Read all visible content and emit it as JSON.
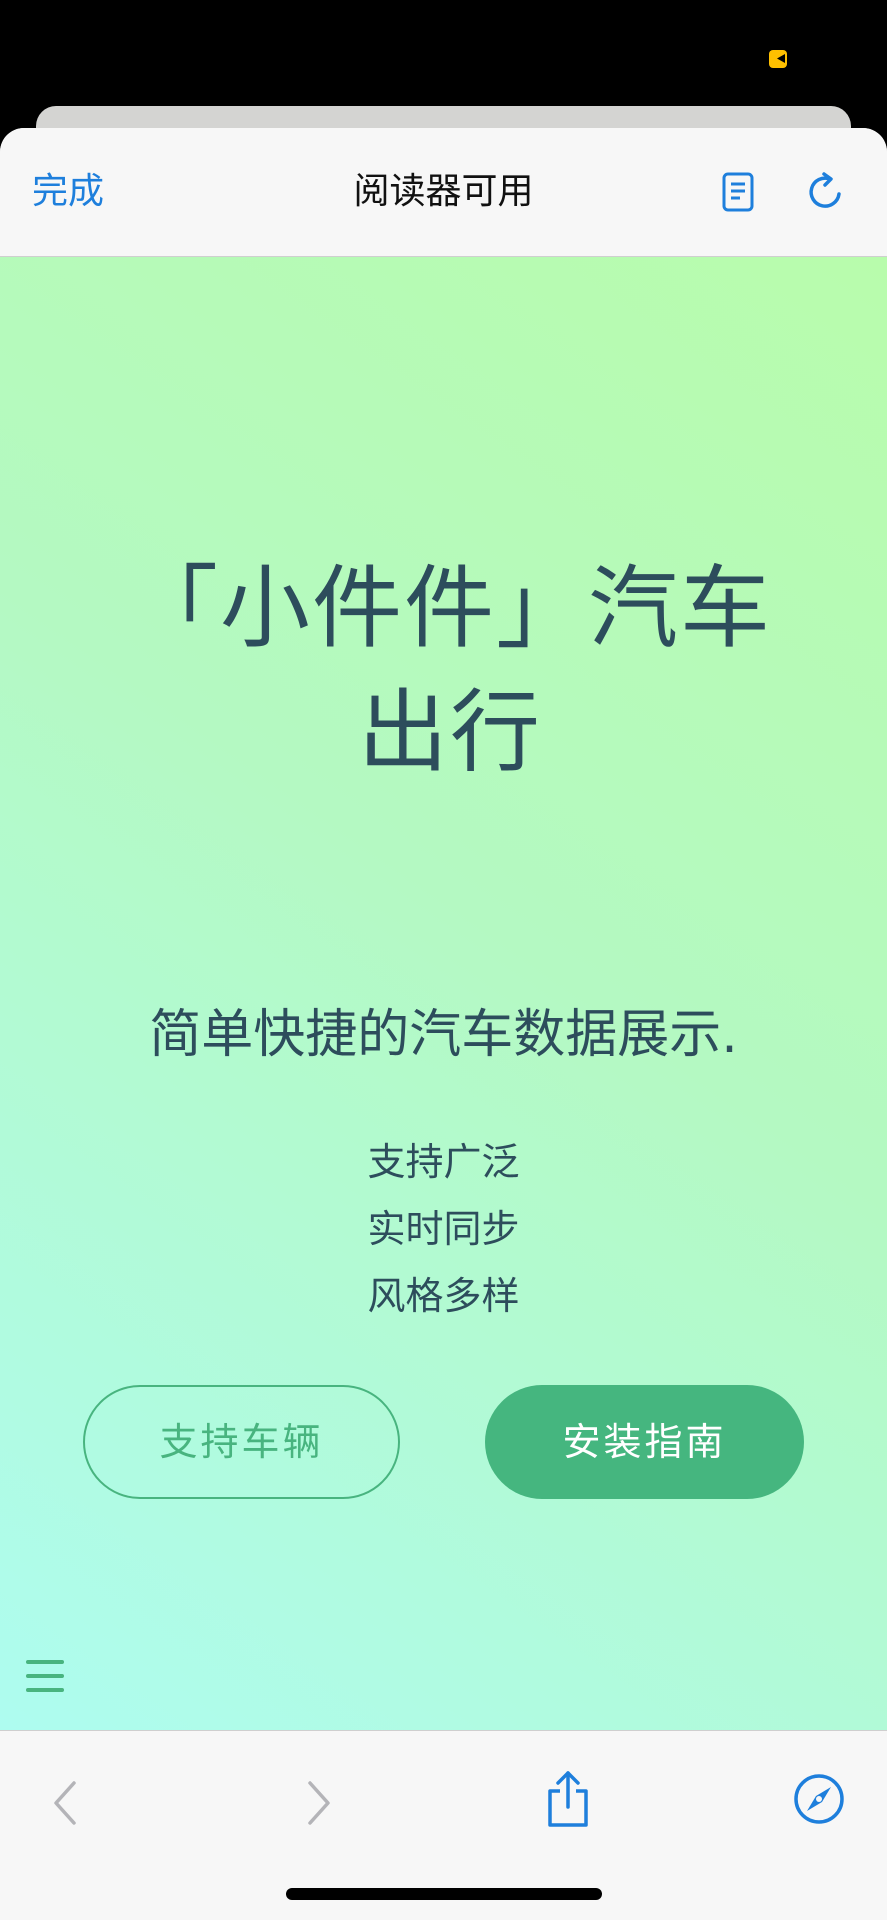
{
  "toolbar": {
    "done_label": "完成",
    "title": "阅读器可用",
    "reader_icon": "reader-mode-icon",
    "reload_icon": "reload-icon"
  },
  "hero": {
    "headline": "「小件件」汽车出行",
    "subtitle": "简单快捷的汽车数据展示.",
    "features": [
      "支持广泛",
      "实时同步",
      "风格多样"
    ],
    "secondary_button": "支持车辆",
    "primary_button": "安装指南"
  },
  "bottom_nav": {
    "back_icon": "chevron-left-icon",
    "forward_icon": "chevron-right-icon",
    "share_icon": "share-icon",
    "compass_icon": "compass-icon"
  },
  "colors": {
    "link_blue": "#1e7fdc",
    "accent_green": "#45b67f",
    "text_dark": "#2d4d5c",
    "gradient_top_right": "#b8fcac",
    "gradient_bottom_left": "#aefcf0"
  }
}
